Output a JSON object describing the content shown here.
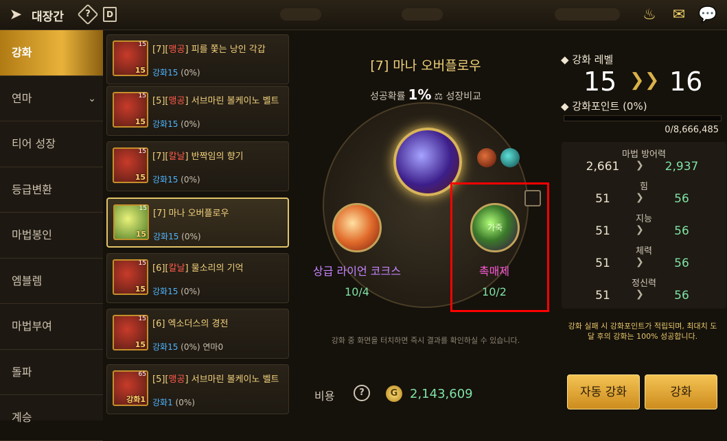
{
  "header": {
    "title": "대장간",
    "help": "?",
    "d_icon": "D"
  },
  "sidebar": {
    "items": [
      {
        "label": "강화",
        "active": true
      },
      {
        "label": "연마",
        "chevron": "⌄"
      },
      {
        "label": "티어 성장"
      },
      {
        "label": "등급변환"
      },
      {
        "label": "마법봉인"
      },
      {
        "label": "엠블렘"
      },
      {
        "label": "마법부여"
      },
      {
        "label": "돌파"
      },
      {
        "label": "계승"
      }
    ]
  },
  "list": {
    "items": [
      {
        "prefix": "[7][",
        "tag": "맹공",
        "name_rest": "] 피를 쫓는 낭인 각갑",
        "sub": "강화15",
        "sub2": " (0%)",
        "lv": "15"
      },
      {
        "prefix": "[5][",
        "tag": "맹공",
        "name_rest": "] 서브마린 볼케이노 벨트",
        "sub": "강화15",
        "sub2": " (0%)",
        "lv": "15"
      },
      {
        "prefix": "[7][",
        "tag": "칼날",
        "name_rest": "] 반짝임의 향기",
        "sub": "강화15",
        "sub2": " (0%)",
        "lv": "15"
      },
      {
        "prefix": "[7] 마나 오버플로우",
        "tag": "",
        "name_rest": "",
        "sub": "강화15",
        "sub2": " (0%)",
        "lv": "15",
        "selected": true
      },
      {
        "prefix": "[6][",
        "tag": "칼날",
        "name_rest": "] 물소리의 기억",
        "sub": "강화15",
        "sub2": " (0%)",
        "lv": "15"
      },
      {
        "prefix": "[6] 엑소더스의 경전",
        "tag": "",
        "name_rest": "",
        "sub": "강화15",
        "sub2": " (0%) 연마0",
        "lv": "15"
      },
      {
        "prefix": "[5][",
        "tag": "맹공",
        "name_rest": "] 서브마린 볼케이노 벨트",
        "sub": "강화1",
        "sub2": " (0%)",
        "lv": "65"
      }
    ]
  },
  "center": {
    "item_title": "[7] 마나 오버플로우",
    "rate_label": "성공확률",
    "rate_value": "1%",
    "compare_label": "성장비교",
    "material1": {
      "name": "상급 라이언 코크스",
      "count": "10/4"
    },
    "material2": {
      "name": "촉매제",
      "count": "10/2",
      "orb_text": "가죽"
    },
    "hint": "강화 중 화면을 터치하면 즉시 결과를 확인하실 수 있습니다.",
    "cost_label": "비용",
    "cost_help": "?",
    "coin_symbol": "G",
    "cost_value": "2,143,609"
  },
  "right": {
    "level_title": "강화 레벨",
    "level_from": "15",
    "level_to": "16",
    "arrow": "❯❯",
    "point_title": "강화포인트 (0%)",
    "point_progress": 0,
    "point_value": "0/8,666,485",
    "stats": [
      {
        "name": "마법 방어력",
        "from": "2,661",
        "to": "2,937"
      },
      {
        "name": "힘",
        "from": "51",
        "to": "56"
      },
      {
        "name": "지능",
        "from": "51",
        "to": "56"
      },
      {
        "name": "체력",
        "from": "51",
        "to": "56"
      },
      {
        "name": "정신력",
        "from": "51",
        "to": "56"
      }
    ],
    "stat_arrow": "❯",
    "note": "강화 실패 시 강화포인트가 적립되며, 최대치 도달 후의 강화는 100% 성공합니다.",
    "auto_button": "자동 강화",
    "upgrade_button": "강화"
  },
  "colors": {
    "accent": "#e8b23a",
    "green": "#7fe3a5",
    "highlight": "#ff0000"
  }
}
